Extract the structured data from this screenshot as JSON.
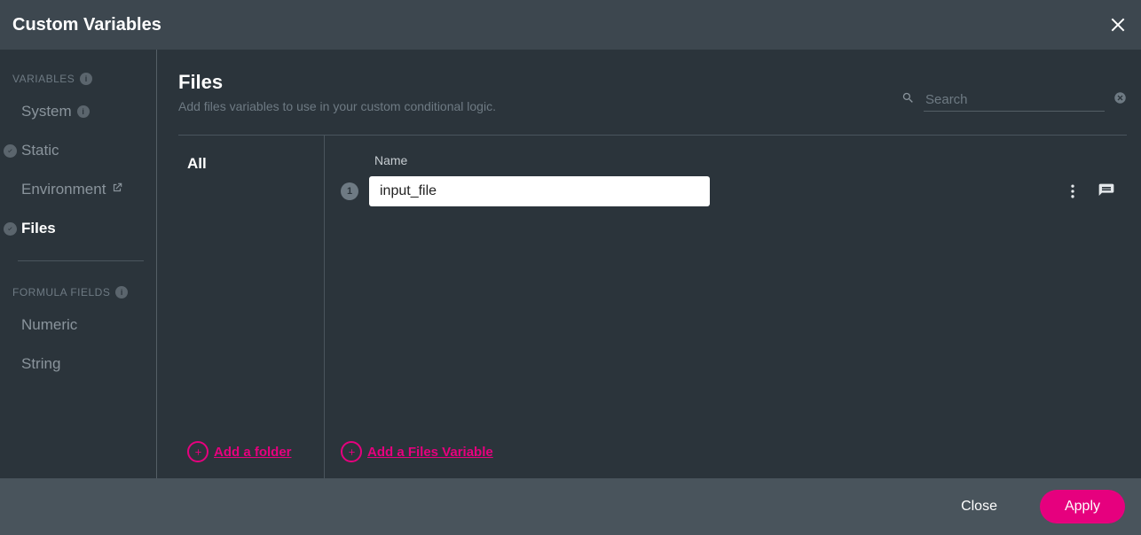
{
  "header": {
    "title": "Custom Variables"
  },
  "sidebar": {
    "section_variables": "VARIABLES",
    "section_formula": "FORMULA FIELDS",
    "items": [
      {
        "label": "System"
      },
      {
        "label": "Static"
      },
      {
        "label": "Environment"
      },
      {
        "label": "Files"
      }
    ],
    "formula_items": [
      {
        "label": "Numeric"
      },
      {
        "label": "String"
      }
    ]
  },
  "main": {
    "title": "Files",
    "subtitle": "Add files variables to use in your custom conditional logic.",
    "search_placeholder": "Search"
  },
  "folders": {
    "all": "All",
    "add_folder": "Add a folder"
  },
  "variables": {
    "column_name": "Name",
    "rows": [
      {
        "index": "1",
        "name": "input_file"
      }
    ],
    "add_variable": "Add a Files Variable"
  },
  "footer": {
    "close": "Close",
    "apply": "Apply"
  }
}
